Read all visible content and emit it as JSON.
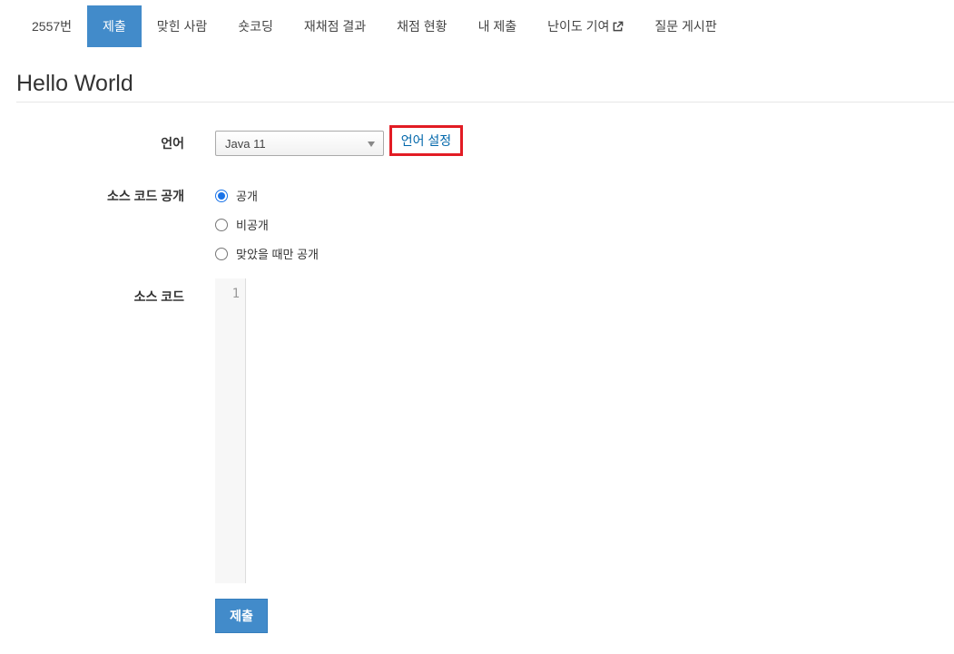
{
  "nav": {
    "items": [
      {
        "label": "2557번",
        "active": false
      },
      {
        "label": "제출",
        "active": true
      },
      {
        "label": "맞힌 사람",
        "active": false
      },
      {
        "label": "숏코딩",
        "active": false
      },
      {
        "label": "재채점 결과",
        "active": false
      },
      {
        "label": "채점 현황",
        "active": false
      },
      {
        "label": "내 제출",
        "active": false
      },
      {
        "label": "난이도 기여",
        "active": false,
        "icon": "external-link-icon"
      },
      {
        "label": "질문 게시판",
        "active": false
      }
    ],
    "active_color": "#428bca"
  },
  "title": "Hello World",
  "form": {
    "language_label": "언어",
    "language_value": "Java 11",
    "language_setting_link": "언어 설정",
    "visibility_label": "소스 코드 공개",
    "visibility_options": [
      {
        "label": "공개",
        "checked": true
      },
      {
        "label": "비공개",
        "checked": false
      },
      {
        "label": "맞았을 때만 공개",
        "checked": false
      }
    ],
    "source_label": "소스 코드",
    "line_number": "1",
    "submit_label": "제출"
  },
  "colors": {
    "highlight_border": "#e21c24",
    "link": "#0066aa",
    "button": "#428bca"
  }
}
